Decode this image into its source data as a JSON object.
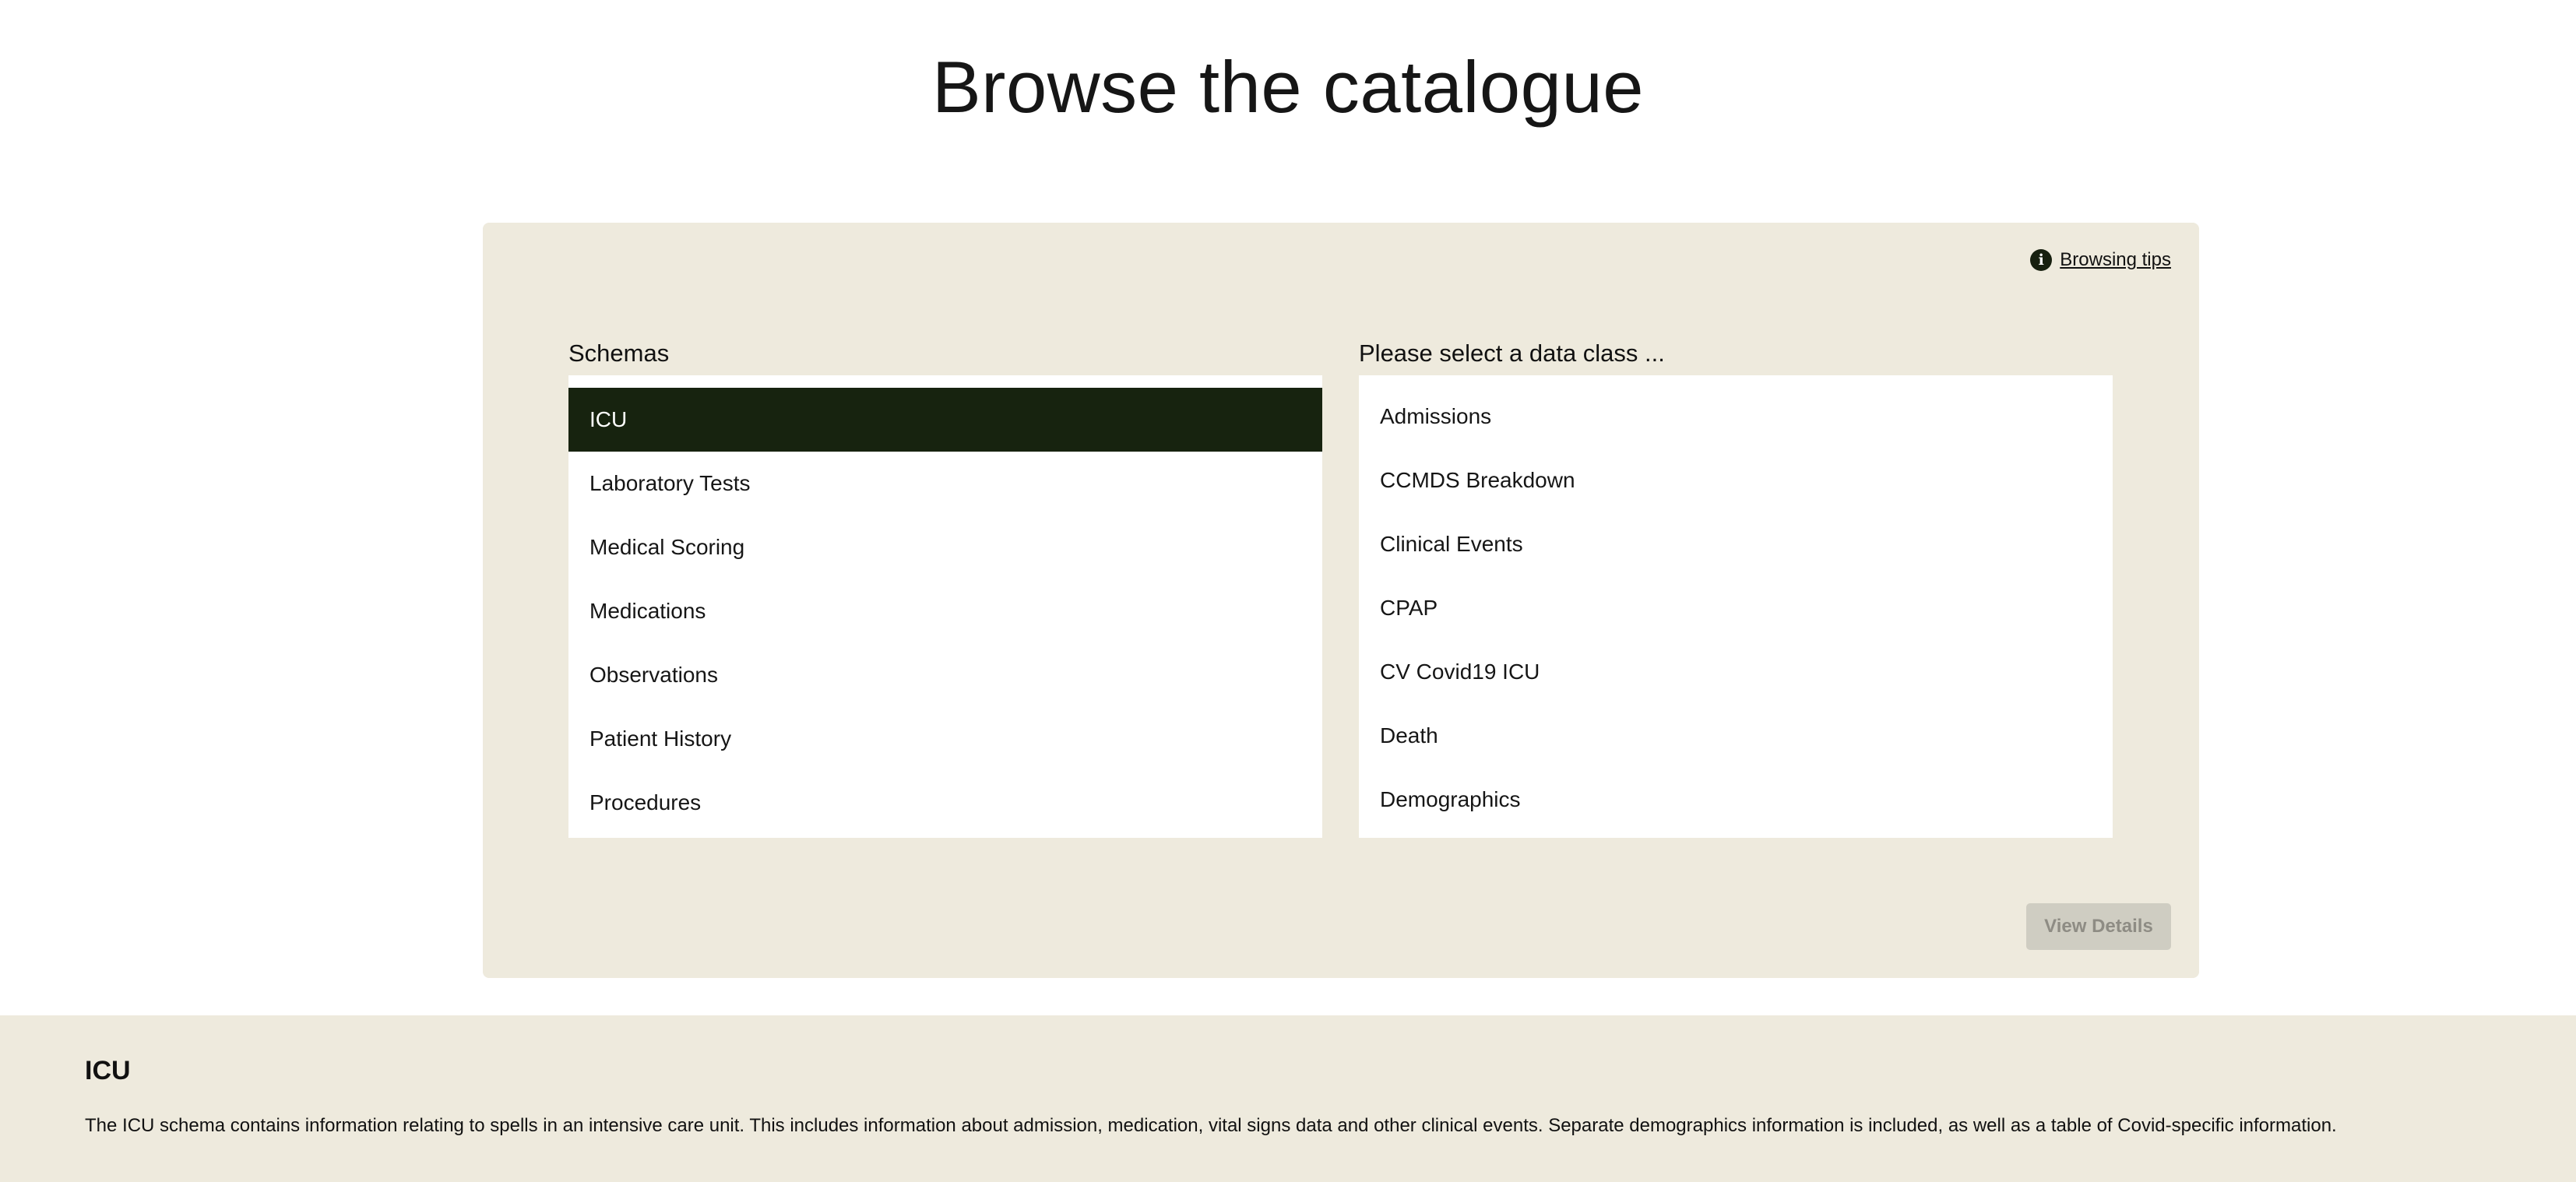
{
  "page": {
    "title": "Browse the catalogue"
  },
  "browser": {
    "tips_label": "Browsing tips",
    "tips_icon": "info-icon",
    "schemas_label": "Schemas",
    "classes_label": "Please select a data class ...",
    "schemas": [
      {
        "label": "ICU",
        "selected": true
      },
      {
        "label": "Laboratory Tests",
        "selected": false
      },
      {
        "label": "Medical Scoring",
        "selected": false
      },
      {
        "label": "Medications",
        "selected": false
      },
      {
        "label": "Observations",
        "selected": false
      },
      {
        "label": "Patient History",
        "selected": false
      },
      {
        "label": "Procedures",
        "selected": false
      }
    ],
    "data_classes": [
      {
        "label": "Admissions"
      },
      {
        "label": "CCMDS Breakdown"
      },
      {
        "label": "Clinical Events"
      },
      {
        "label": "CPAP"
      },
      {
        "label": "CV Covid19 ICU"
      },
      {
        "label": "Death"
      },
      {
        "label": "Demographics"
      }
    ],
    "view_details_label": "View Details",
    "view_details_enabled": false
  },
  "details": {
    "title": "ICU",
    "description": "The ICU schema contains information relating to spells in an intensive care unit. This includes information about admission, medication, vital signs data and other clinical events. Separate demographics information is included, as well as a table of Covid-specific information."
  },
  "colors": {
    "panel_bg": "#eeeadd",
    "selected_bg": "#17230f",
    "disabled_button_bg": "#cfcdc2"
  }
}
